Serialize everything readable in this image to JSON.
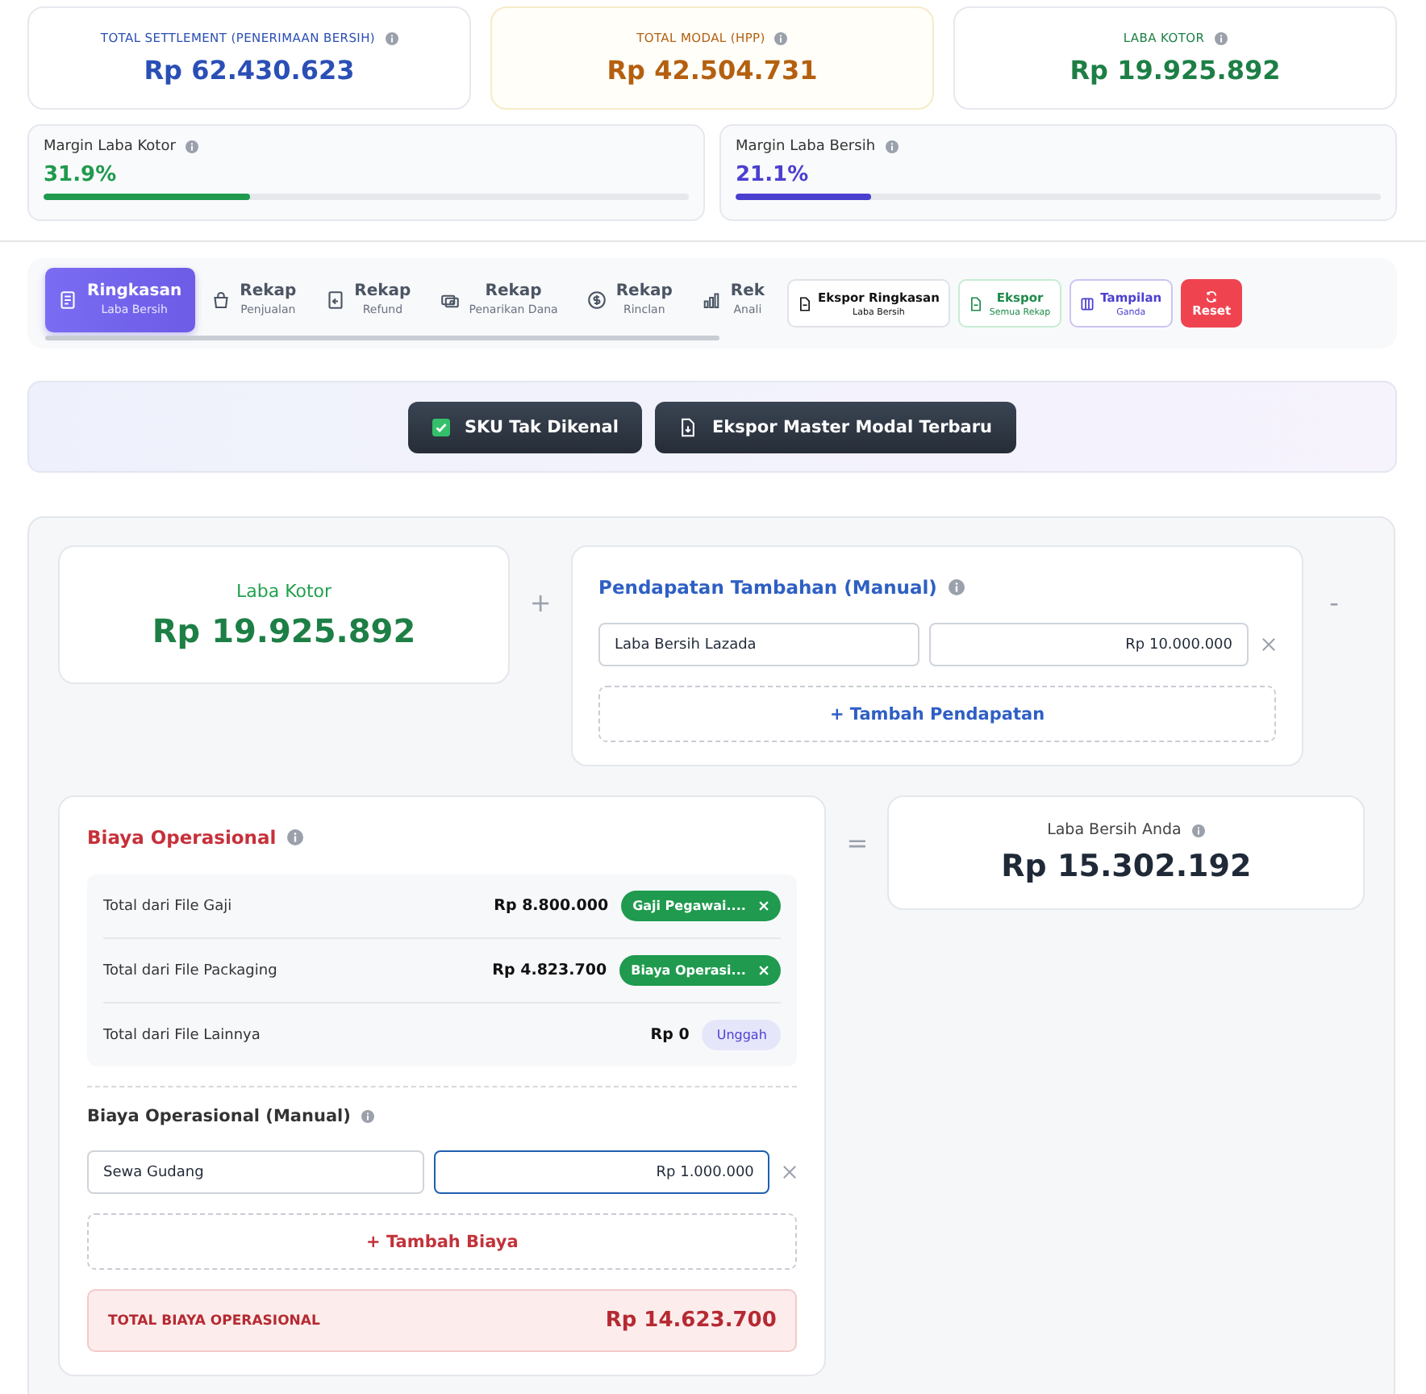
{
  "summary_cards": [
    {
      "label": "TOTAL SETTLEMENT (PENERIMAAN BERSIH)",
      "value": "Rp 62.430.623",
      "color": "#2a4fb5"
    },
    {
      "label": "TOTAL MODAL (HPP)",
      "value": "Rp 42.504.731",
      "color": "#b4600f"
    },
    {
      "label": "LABA KOTOR",
      "value": "Rp 19.925.892",
      "color": "#1d7f45"
    }
  ],
  "margins": [
    {
      "label": "Margin Laba Kotor",
      "value": "31.9%",
      "level": 0.319,
      "color": "#1f9a4e"
    },
    {
      "label": "Margin Laba Bersih",
      "value": "21.1%",
      "level": 0.211,
      "color": "#4b3fd0"
    }
  ],
  "tabs": [
    {
      "title": "Ringkasan",
      "subtitle": "Laba Bersih",
      "selected": true
    },
    {
      "title": "Rekap",
      "subtitle": "Penjualan",
      "selected": false
    },
    {
      "title": "Rekap",
      "subtitle": "Refund",
      "selected": false
    },
    {
      "title": "Rekap",
      "subtitle": "Penarikan Dana",
      "selected": false
    },
    {
      "title": "Rekap",
      "subtitle": "Rinclan",
      "selected": false
    },
    {
      "title": "Rek",
      "subtitle": "Anali",
      "selected": false
    }
  ],
  "export_buttons": [
    {
      "kind": "plain",
      "title": "Ekspor Ringkasan",
      "subtitle": "Laba Bersih"
    },
    {
      "kind": "green",
      "title": "Ekspor",
      "subtitle": "Semua Rekap"
    },
    {
      "kind": "purple",
      "title": "Tampilan",
      "subtitle": "Ganda"
    },
    {
      "kind": "danger",
      "title": "Reset"
    }
  ],
  "action_buttons": [
    {
      "label": "SKU Tak Dikenal"
    },
    {
      "label": "Ekspor Master Modal Terbaru"
    }
  ],
  "laba_kotor": {
    "label": "Laba Kotor",
    "value": "Rp 19.925.892"
  },
  "plus_sign": "+",
  "minus_sign": "-",
  "equals_sign": "=",
  "pendapatan": {
    "title": "Pendapatan Tambahan (Manual)",
    "items": [
      {
        "name": "Laba Bersih Lazada",
        "amount": "Rp 10.000.000",
        "focused": false
      }
    ],
    "add_label": "+ Tambah Pendapatan"
  },
  "biaya": {
    "title": "Biaya Operasional",
    "files": [
      {
        "label": "Total dari File Gaji",
        "amount": "Rp 8.800.000",
        "kind": "file",
        "tag": "Gaji Pegawai...."
      },
      {
        "label": "Total dari File Packaging",
        "amount": "Rp 4.823.700",
        "kind": "file",
        "tag": "Biaya Operasi..."
      },
      {
        "label": "Total dari File Lainnya",
        "amount": "Rp 0",
        "kind": "upload",
        "tag": "Unggah"
      }
    ],
    "manual_title": "Biaya Operasional (Manual)",
    "items": [
      {
        "name": "Sewa Gudang",
        "amount": "Rp 1.000.000",
        "focused": true
      }
    ],
    "add_label": "+ Tambah Biaya",
    "total_label": "TOTAL BIAYA OPERASIONAL",
    "total_value": "Rp 14.623.700"
  },
  "laba_bersih": {
    "label": "Laba Bersih Anda",
    "value": "Rp 15.302.192"
  }
}
